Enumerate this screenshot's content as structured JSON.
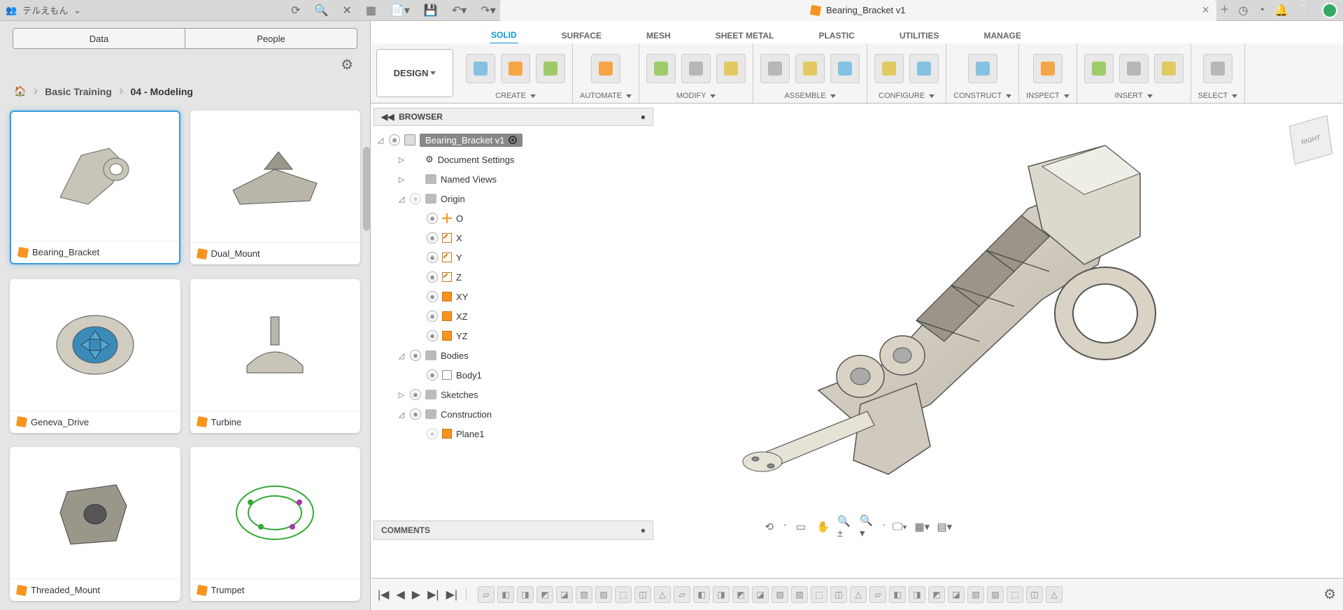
{
  "topbar": {
    "user_label": "テルえもん",
    "doc_title": "Bearing_Bracket v1",
    "plus": "+"
  },
  "left_panel": {
    "data_btn": "Data",
    "people_btn": "People",
    "breadcrumb": [
      "Basic Training",
      "04 - Modeling"
    ],
    "thumbs": [
      {
        "name": "Bearing_Bracket",
        "selected": true
      },
      {
        "name": "Dual_Mount",
        "selected": false
      },
      {
        "name": "Geneva_Drive",
        "selected": false
      },
      {
        "name": "Turbine",
        "selected": false
      },
      {
        "name": "Threaded_Mount",
        "selected": false
      },
      {
        "name": "Trumpet",
        "selected": false
      }
    ]
  },
  "ribbon": {
    "design_btn": "DESIGN",
    "tabs": [
      "SOLID",
      "SURFACE",
      "MESH",
      "SHEET METAL",
      "PLASTIC",
      "UTILITIES",
      "MANAGE"
    ],
    "active_tab": "SOLID",
    "groups": [
      {
        "label": "CREATE",
        "icons": 3
      },
      {
        "label": "AUTOMATE",
        "icons": 1
      },
      {
        "label": "MODIFY",
        "icons": 3
      },
      {
        "label": "ASSEMBLE",
        "icons": 3
      },
      {
        "label": "CONFIGURE",
        "icons": 2
      },
      {
        "label": "CONSTRUCT",
        "icons": 1
      },
      {
        "label": "INSPECT",
        "icons": 1
      },
      {
        "label": "INSERT",
        "icons": 3
      },
      {
        "label": "SELECT",
        "icons": 1
      }
    ]
  },
  "browser": {
    "title": "BROWSER",
    "root": "Bearing_Bracket v1",
    "nodes": [
      {
        "indent": 1,
        "type": "settings",
        "label": "Document Settings",
        "exp": "▷",
        "eye": null
      },
      {
        "indent": 1,
        "type": "folder",
        "label": "Named Views",
        "exp": "▷",
        "eye": null
      },
      {
        "indent": 1,
        "type": "folder",
        "label": "Origin",
        "exp": "◿",
        "eye": "off"
      },
      {
        "indent": 2,
        "type": "origin",
        "label": "O",
        "exp": null,
        "eye": "on"
      },
      {
        "indent": 2,
        "type": "axis",
        "label": "X",
        "exp": null,
        "eye": "on"
      },
      {
        "indent": 2,
        "type": "axis",
        "label": "Y",
        "exp": null,
        "eye": "on"
      },
      {
        "indent": 2,
        "type": "axis",
        "label": "Z",
        "exp": null,
        "eye": "on"
      },
      {
        "indent": 2,
        "type": "plane",
        "label": "XY",
        "exp": null,
        "eye": "on"
      },
      {
        "indent": 2,
        "type": "plane",
        "label": "XZ",
        "exp": null,
        "eye": "on"
      },
      {
        "indent": 2,
        "type": "plane",
        "label": "YZ",
        "exp": null,
        "eye": "on"
      },
      {
        "indent": 1,
        "type": "folder",
        "label": "Bodies",
        "exp": "◿",
        "eye": "on"
      },
      {
        "indent": 2,
        "type": "body",
        "label": "Body1",
        "exp": null,
        "eye": "on"
      },
      {
        "indent": 1,
        "type": "folder",
        "label": "Sketches",
        "exp": "▷",
        "eye": "on"
      },
      {
        "indent": 1,
        "type": "folder",
        "label": "Construction",
        "exp": "◿",
        "eye": "on"
      },
      {
        "indent": 2,
        "type": "plane",
        "label": "Plane1",
        "exp": null,
        "eye": "off"
      }
    ]
  },
  "comments": {
    "title": "COMMENTS"
  },
  "timeline": {
    "item_count": 30
  },
  "viewcube": {
    "face": "RIGHT"
  }
}
